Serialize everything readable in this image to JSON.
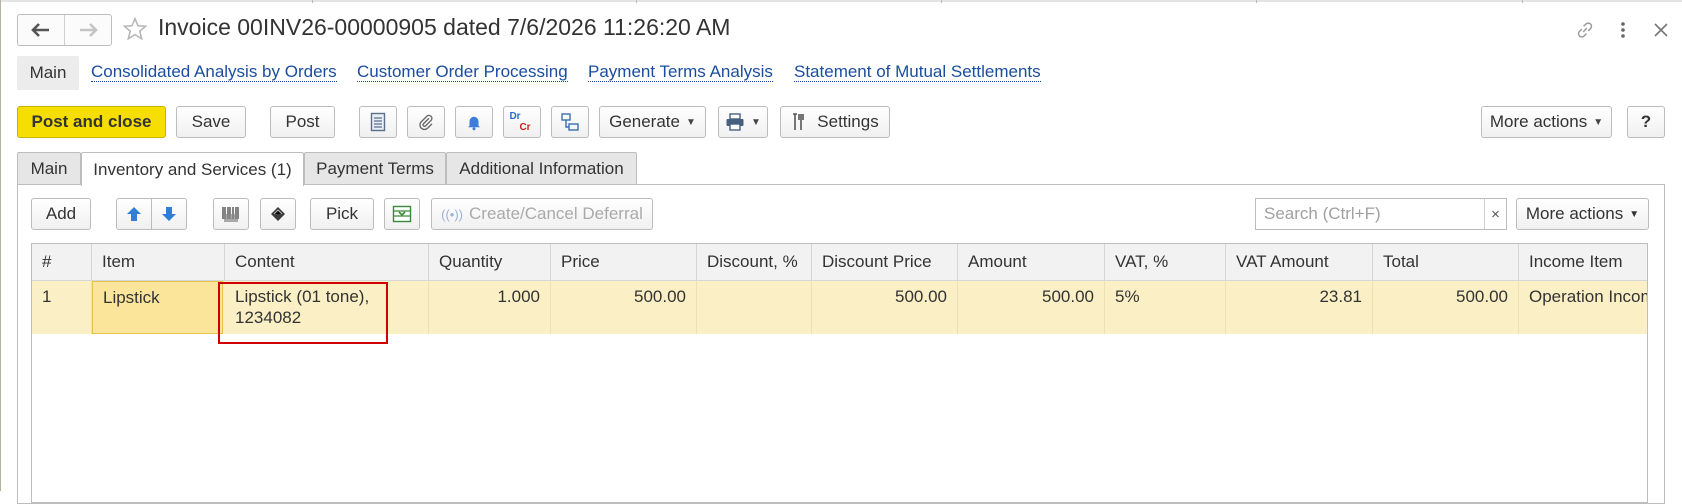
{
  "window": {
    "title": "Invoice 00INV26-00000905 dated 7/6/2026 11:26:20 AM",
    "icons": [
      "back-arrow-icon",
      "forward-arrow-icon",
      "star-icon",
      "link-icon",
      "kebab-menu-icon",
      "close-icon"
    ]
  },
  "sections": {
    "main": "Main",
    "links": [
      "Consolidated Analysis by Orders",
      "Customer Order Processing",
      "Payment Terms Analysis",
      "Statement of Mutual Settlements"
    ]
  },
  "toolbar": {
    "post_and_close": "Post and close",
    "save": "Save",
    "post": "Post",
    "generate": "Generate",
    "settings": "Settings",
    "more_actions": "More actions",
    "help": "?",
    "debit_credit_top": "Dr",
    "debit_credit_bottom": "Cr"
  },
  "tabs": [
    "Main",
    "Inventory and Services (1)",
    "Payment Terms",
    "Additional Information"
  ],
  "active_tab": "Inventory and Services (1)",
  "table_toolbar": {
    "add": "Add",
    "pick": "Pick",
    "create_cancel_deferral": "Create/Cancel Deferral",
    "search_placeholder": "Search (Ctrl+F)",
    "clear": "×",
    "more_actions": "More actions"
  },
  "table": {
    "columns": [
      "#",
      "Item",
      "Content",
      "Quantity",
      "Price",
      "Discount, %",
      "Discount Price",
      "Amount",
      "VAT, %",
      "VAT Amount",
      "Total",
      "Income Item"
    ],
    "rows": [
      {
        "num": "1",
        "item": "Lipstick",
        "content": "Lipstick (01 tone), 1234082",
        "quantity": "1.000",
        "price": "500.00",
        "discount_pct": "",
        "discount_price": "500.00",
        "amount": "500.00",
        "vat_pct": "5%",
        "vat_amount": "23.81",
        "total": "500.00",
        "income_item": "Operation Income"
      }
    ]
  },
  "colors": {
    "primary_button": "#f6de00",
    "link": "#1a4d9e",
    "selected_row": "#fbf0c5",
    "highlight_box": "#d00000"
  }
}
